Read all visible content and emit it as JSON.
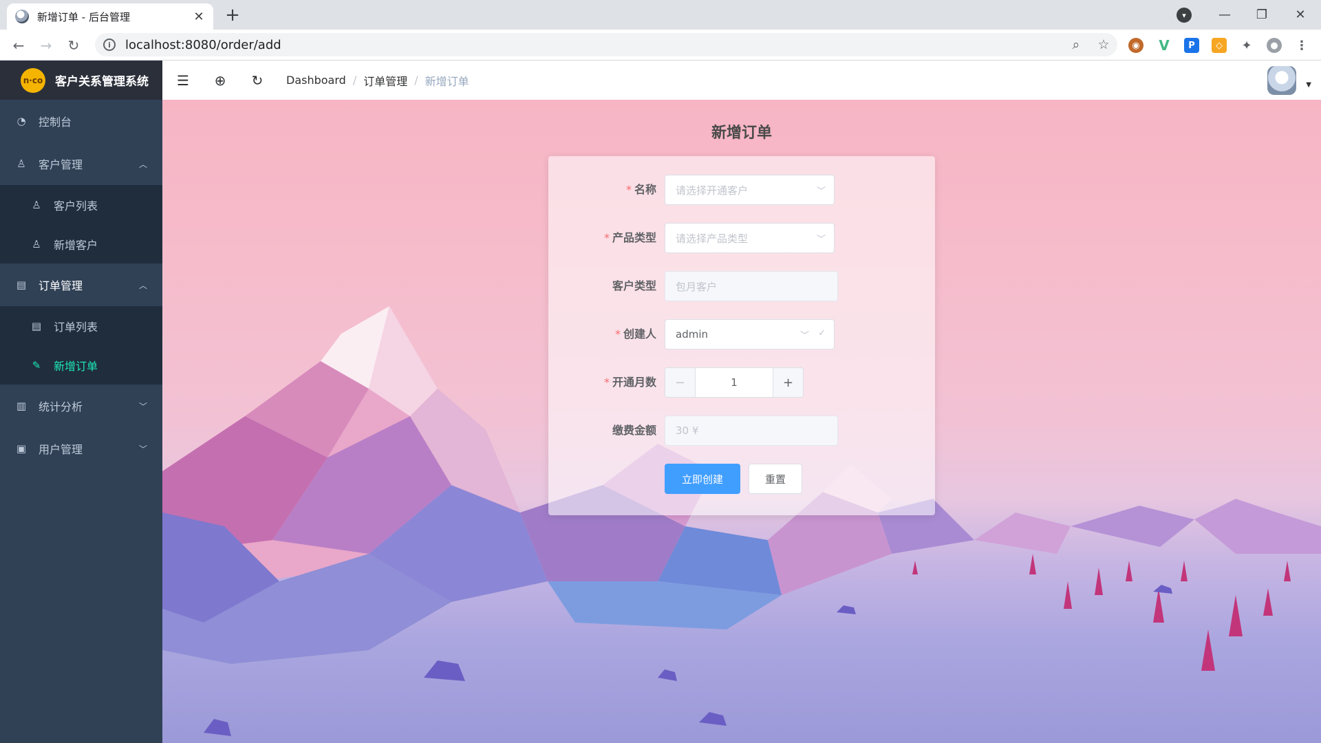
{
  "browser": {
    "tab_title": "新增订单 - 后台管理",
    "url": "localhost:8080/order/add"
  },
  "app": {
    "logo_text": "n·co",
    "title": "客户关系管理系统"
  },
  "sidebar": {
    "dashboard": "控制台",
    "customer_mgmt": "客户管理",
    "customer_list": "客户列表",
    "add_customer": "新增客户",
    "order_mgmt": "订单管理",
    "order_list": "订单列表",
    "add_order": "新增订单",
    "statistics": "统计分析",
    "user_mgmt": "用户管理"
  },
  "breadcrumb": {
    "root": "Dashboard",
    "section": "订单管理",
    "current": "新增订单",
    "separator": "/"
  },
  "page": {
    "title": "新增订单"
  },
  "form": {
    "name_label": "名称",
    "name_placeholder": "请选择开通客户",
    "product_label": "产品类型",
    "product_placeholder": "请选择产品类型",
    "customer_type_label": "客户类型",
    "customer_type_value": "包月客户",
    "creator_label": "创建人",
    "creator_value": "admin",
    "months_label": "开通月数",
    "months_value": "1",
    "fee_label": "缴费金额",
    "fee_value": "30 ¥",
    "submit": "立即创建",
    "reset": "重置",
    "required_mark": "*"
  },
  "colors": {
    "sidebar_bg": "#304156",
    "active_menu": "#1de9b6",
    "primary": "#409eff"
  }
}
